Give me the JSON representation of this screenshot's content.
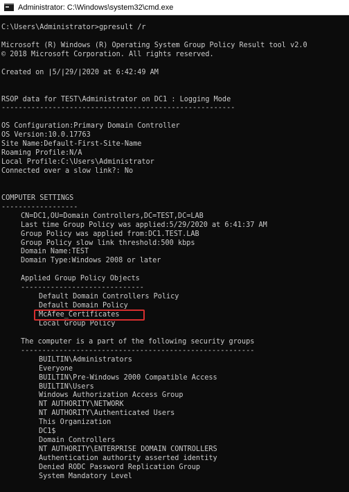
{
  "window": {
    "title": "Administrator: C:\\Windows\\system32\\cmd.exe"
  },
  "console": {
    "prompt": "C:\\Users\\Administrator>gpresult /r",
    "banner1": "Microsoft (R) Windows (R) Operating System Group Policy Result tool v2.0",
    "banner2": "© 2018 Microsoft Corporation. All rights reserved.",
    "created": "Created on ⌠5/⌠29/⌠2020 at 6:42:49 AM",
    "rsop": "RSOP data for TEST\\Administrator on DC1 : Logging Mode",
    "rsop_underline": "-------------------------------------------------------",
    "info": [
      {
        "key": "OS Configuration:",
        "value": "Primary Domain Controller"
      },
      {
        "key": "OS Version:",
        "value": "10.0.17763"
      },
      {
        "key": "Site Name:",
        "value": "Default-First-Site-Name"
      },
      {
        "key": "Roaming Profile:",
        "value": "N/A"
      },
      {
        "key": "Local Profile:",
        "value": "C:\\Users\\Administrator"
      }
    ],
    "slow_link": "Connected over a slow link?: No",
    "computer_settings": "COMPUTER SETTINGS",
    "cs_underline": "------------------",
    "dn": "CN=DC1,OU=Domain Controllers,DC=TEST,DC=LAB",
    "settings": [
      {
        "key": "Last time Group Policy was applied:",
        "value": "5/29/2020 at 6:41:37 AM"
      },
      {
        "key": "Group Policy was applied from:",
        "value": "DC1.TEST.LAB"
      },
      {
        "key": "Group Policy slow link threshold:",
        "value": "500 kbps"
      },
      {
        "key": "Domain Name:",
        "value": "TEST"
      },
      {
        "key": "Domain Type:",
        "value": "Windows 2008 or later"
      }
    ],
    "applied_heading": "Applied Group Policy Objects",
    "applied_underline": "-----------------------------",
    "gpos": [
      "Default Domain Controllers Policy",
      "Default Domain Policy",
      "McAfee_Certificates",
      "Local Group Policy"
    ],
    "groups_heading": "The computer is a part of the following security groups",
    "groups_underline": "-------------------------------------------------------",
    "groups": [
      "BUILTIN\\Administrators",
      "Everyone",
      "BUILTIN\\Pre-Windows 2000 Compatible Access",
      "BUILTIN\\Users",
      "Windows Authorization Access Group",
      "NT AUTHORITY\\NETWORK",
      "NT AUTHORITY\\Authenticated Users",
      "This Organization",
      "DC1$",
      "Domain Controllers",
      "NT AUTHORITY\\ENTERPRISE DOMAIN CONTROLLERS",
      "Authentication authority asserted identity",
      "Denied RODC Password Replication Group",
      "System Mandatory Level"
    ]
  }
}
